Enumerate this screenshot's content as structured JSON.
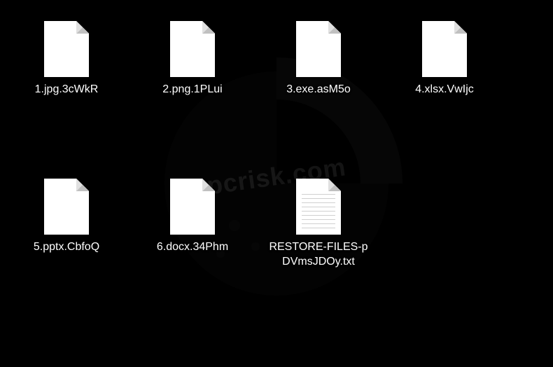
{
  "watermark_text": "pcrisk.com",
  "files": [
    {
      "name": "1.jpg.3cWkR",
      "type": "blank"
    },
    {
      "name": "2.png.1PLui",
      "type": "blank"
    },
    {
      "name": "3.exe.asM5o",
      "type": "blank"
    },
    {
      "name": "4.xlsx.VwIjc",
      "type": "blank"
    },
    {
      "name": "5.pptx.CbfoQ",
      "type": "blank"
    },
    {
      "name": "6.docx.34Phm",
      "type": "blank"
    },
    {
      "name": "RESTORE-FILES-pDVmsJDOy.txt",
      "type": "text"
    }
  ]
}
